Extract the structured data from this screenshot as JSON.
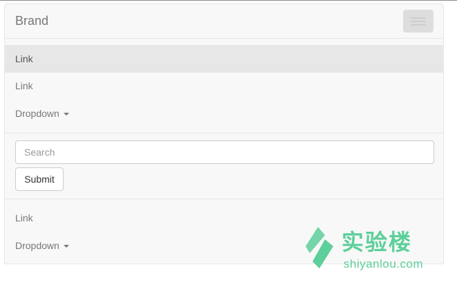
{
  "navbar": {
    "brand": "Brand",
    "toggle_icon": "hamburger-icon",
    "items_primary": [
      {
        "label": "Link",
        "active": true
      },
      {
        "label": "Link",
        "active": false
      },
      {
        "label": "Dropdown",
        "dropdown": true
      }
    ],
    "search": {
      "placeholder": "Search",
      "value": ""
    },
    "submit_label": "Submit",
    "items_secondary": [
      {
        "label": "Link"
      },
      {
        "label": "Dropdown",
        "dropdown": true
      }
    ]
  },
  "watermark": {
    "name": "实验楼",
    "url": "shiyanlou.com",
    "color": "#5dcf9a"
  },
  "colors": {
    "navbar_bg": "#f8f8f8",
    "active_bg": "#e7e7e7",
    "border": "#e7e7e7"
  }
}
